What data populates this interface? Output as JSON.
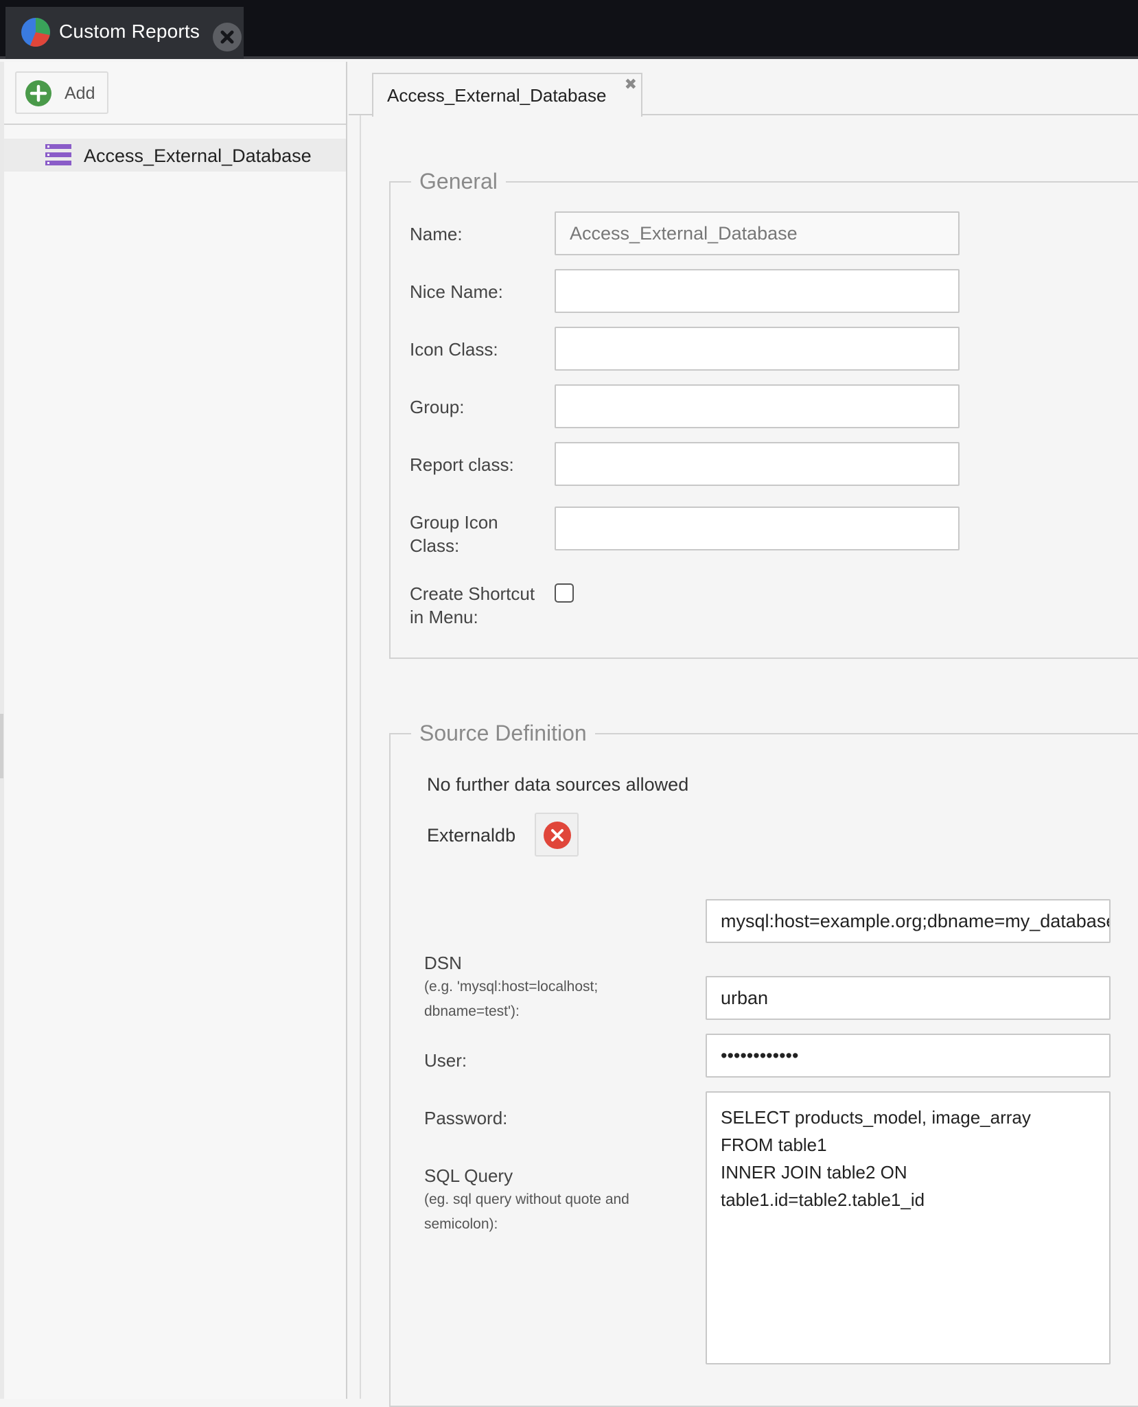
{
  "app": {
    "tab_title": "Custom Reports"
  },
  "sidebar": {
    "add_label": "Add",
    "items": [
      {
        "label": "Access_External_Database"
      }
    ]
  },
  "editor": {
    "tab_label": "Access_External_Database",
    "tab_close_glyph": "✖",
    "general": {
      "legend": "General",
      "name_label": "Name:",
      "name_value": "Access_External_Database",
      "nice_name_label": "Nice Name:",
      "nice_name_value": "",
      "icon_class_label": "Icon Class:",
      "icon_class_value": "",
      "group_label": "Group:",
      "group_value": "",
      "report_class_label": "Report class:",
      "report_class_value": "",
      "group_icon_label_1": "Group Icon",
      "group_icon_label_2": "Class:",
      "group_icon_value": "",
      "shortcut_label_1": "Create Shortcut",
      "shortcut_label_2": "in Menu:",
      "shortcut_checked": false
    },
    "source": {
      "legend": "Source Definition",
      "notice": "No further data sources allowed",
      "adapter_name": "Externaldb",
      "dsn_label": "DSN",
      "dsn_hint_1": "(e.g. 'mysql:host=localhost;",
      "dsn_hint_2": "dbname=test'):",
      "dsn_value": "mysql:host=example.org;dbname=my_database",
      "user_label": "User:",
      "user_value": "urban",
      "password_label": "Password:",
      "password_value": "••••••••••••",
      "sql_label": "SQL Query",
      "sql_hint_1": "(eg. sql query without quote and",
      "sql_hint_2": "semicolon):",
      "sql_value": "SELECT products_model, image_array\nFROM table1\nINNER JOIN table2 ON\ntable1.id=table2.table1_id"
    }
  },
  "colors": {
    "topbar": "#101116",
    "add_icon": "#4a9a4a",
    "list_icon": "#8a5cc8",
    "remove_icon": "#e0463a"
  }
}
